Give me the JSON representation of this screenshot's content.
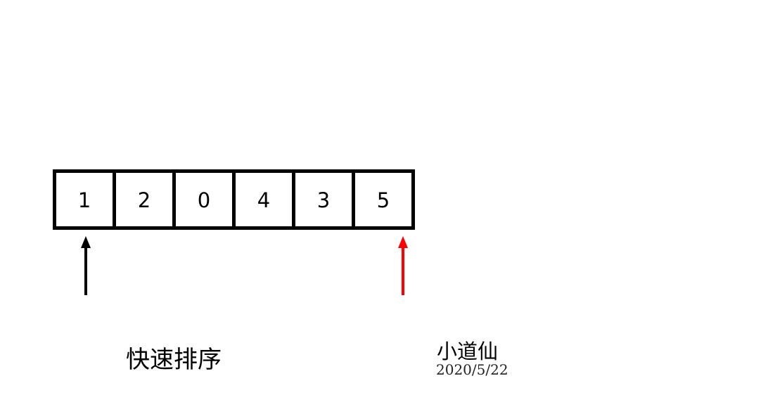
{
  "array": {
    "cells": [
      {
        "label": "1"
      },
      {
        "label": "2"
      },
      {
        "label": "0"
      },
      {
        "label": "4"
      },
      {
        "label": "3"
      },
      {
        "label": "5"
      }
    ]
  },
  "pointers": {
    "left": {
      "color": "#000000",
      "points_to_cell": 1
    },
    "right": {
      "color": "#ff0000",
      "points_to_cell": 6
    }
  },
  "caption": {
    "title": "快速排序",
    "author": "小道仙",
    "date": "2020/5/22"
  }
}
